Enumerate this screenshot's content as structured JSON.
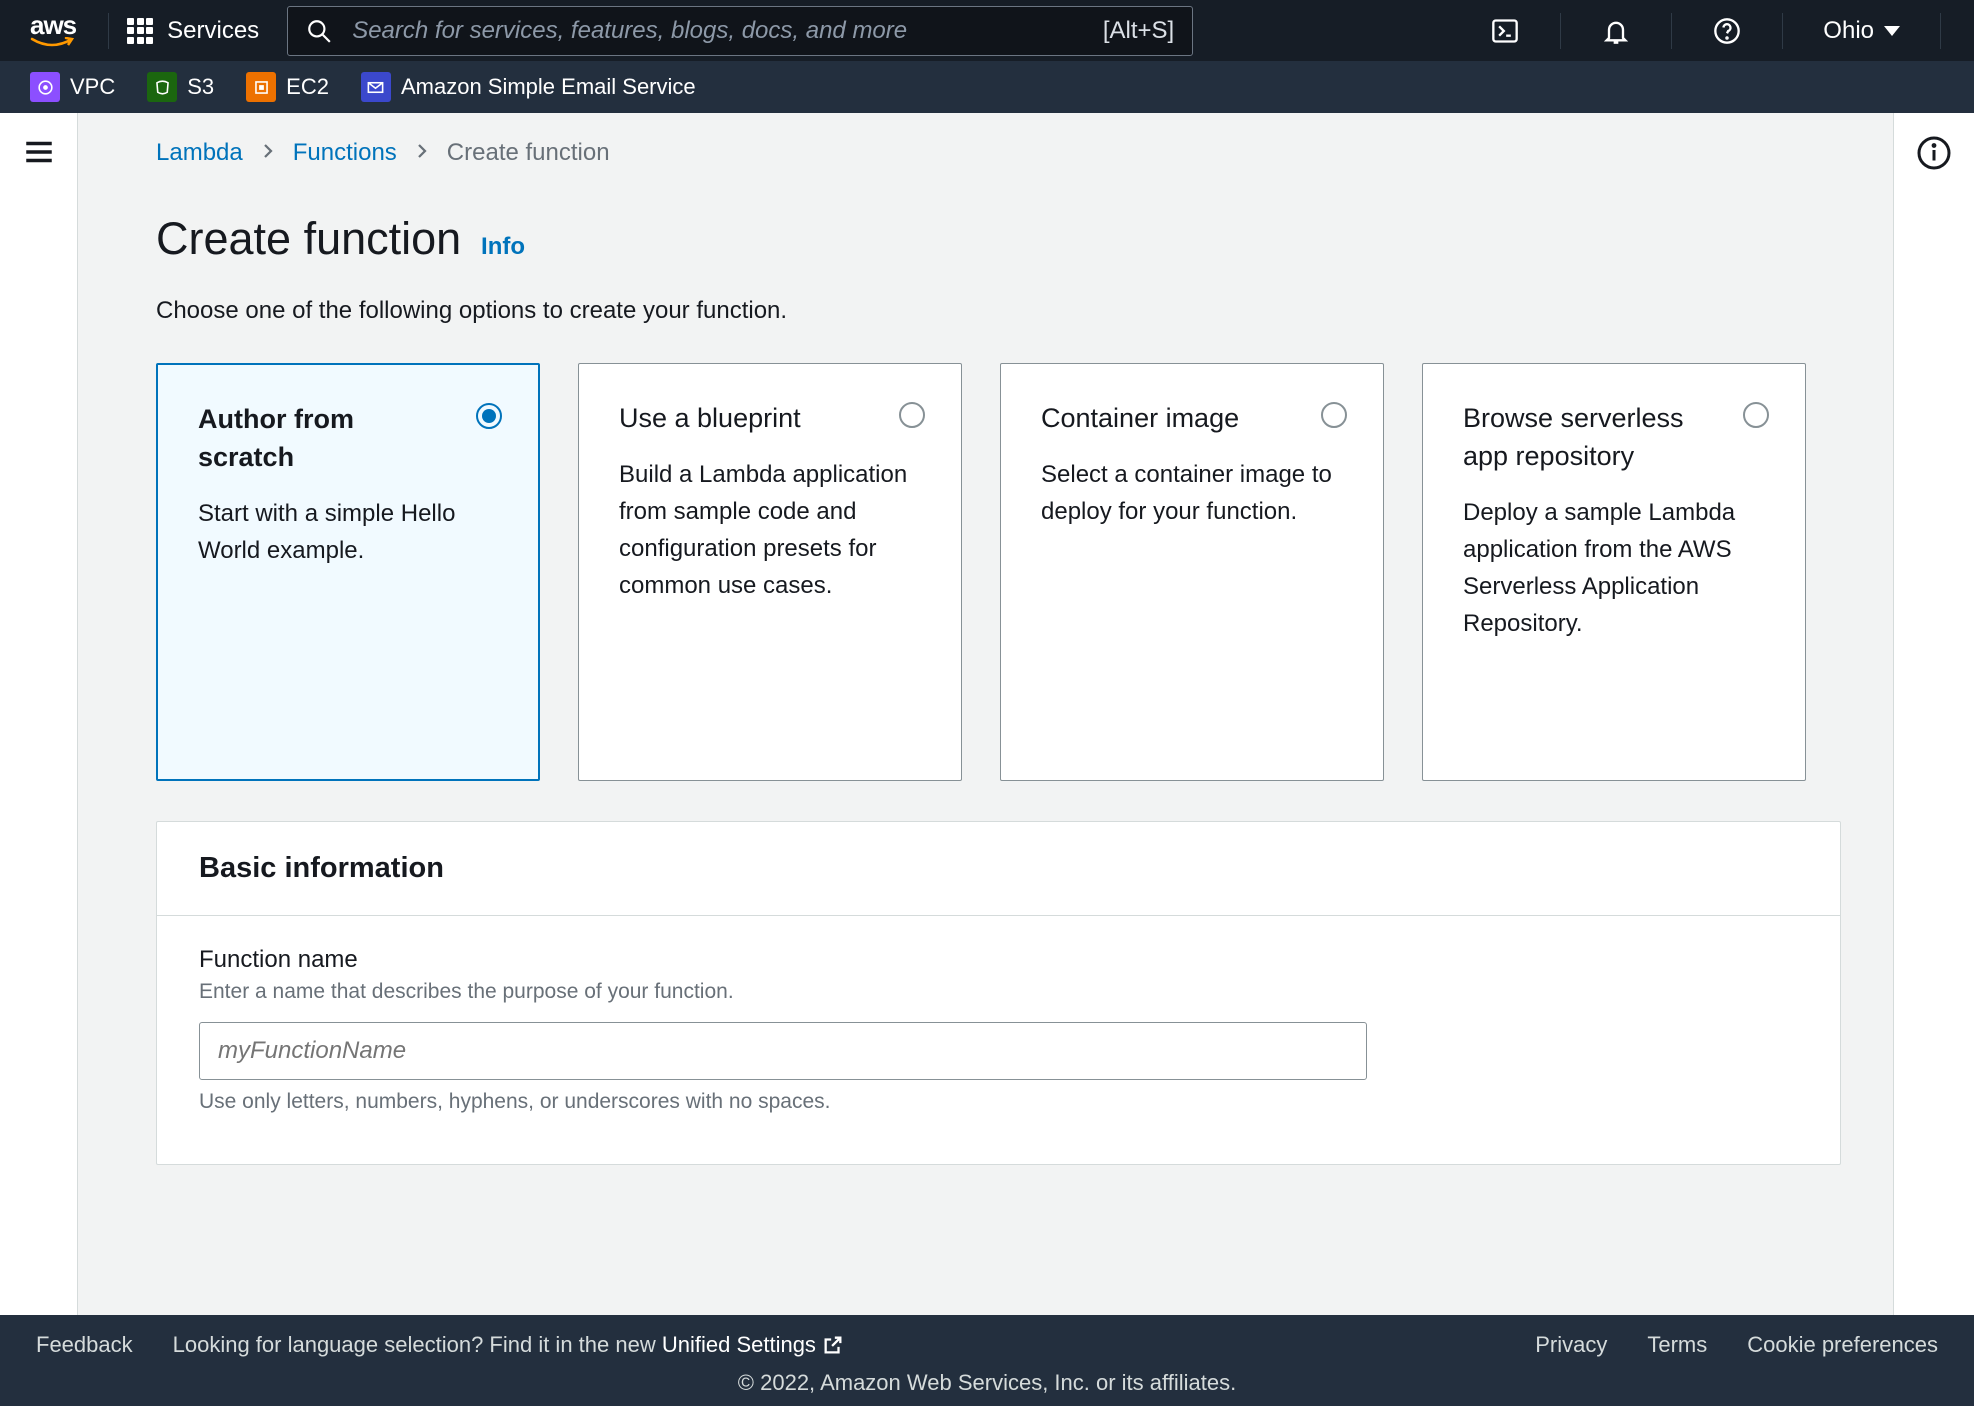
{
  "header": {
    "services_label": "Services",
    "search_placeholder": "Search for services, features, blogs, docs, and more",
    "search_shortcut": "[Alt+S]",
    "region": "Ohio"
  },
  "service_bar": [
    {
      "id": "vpc",
      "label": "VPC"
    },
    {
      "id": "s3",
      "label": "S3"
    },
    {
      "id": "ec2",
      "label": "EC2"
    },
    {
      "id": "ses",
      "label": "Amazon Simple Email Service"
    }
  ],
  "breadcrumbs": {
    "a": "Lambda",
    "b": "Functions",
    "c": "Create function"
  },
  "page": {
    "title": "Create function",
    "info": "Info",
    "subtitle": "Choose one of the following options to create your function."
  },
  "options": [
    {
      "title": "Author from scratch",
      "desc": "Start with a simple Hello World example.",
      "selected": true
    },
    {
      "title": "Use a blueprint",
      "desc": "Build a Lambda application from sample code and configuration presets for common use cases.",
      "selected": false
    },
    {
      "title": "Container image",
      "desc": "Select a container image to deploy for your function.",
      "selected": false
    },
    {
      "title": "Browse serverless app repository",
      "desc": "Deploy a sample Lambda application from the AWS Serverless Application Repository.",
      "selected": false
    }
  ],
  "basic_info": {
    "heading": "Basic information",
    "function_name": {
      "label": "Function name",
      "hint": "Enter a name that describes the purpose of your function.",
      "placeholder": "myFunctionName",
      "note": "Use only letters, numbers, hyphens, or underscores with no spaces."
    }
  },
  "footer": {
    "feedback": "Feedback",
    "lang_prompt": "Looking for language selection? Find it in the new ",
    "unified": "Unified Settings",
    "privacy": "Privacy",
    "terms": "Terms",
    "cookies": "Cookie preferences",
    "copyright": "© 2022, Amazon Web Services, Inc. or its affiliates."
  }
}
